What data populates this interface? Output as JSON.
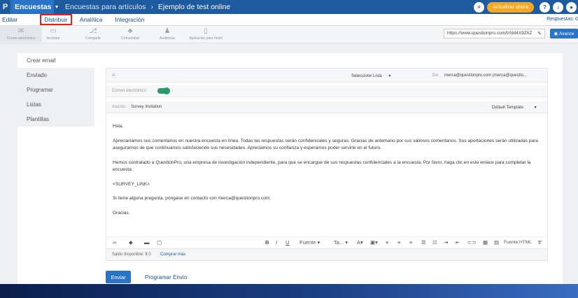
{
  "topbar": {
    "logo": "P",
    "app_menu": "Encuestas",
    "breadcrumb": "Encuestas para artículos",
    "breadcrumb_sep": "›",
    "survey_title": "Ejemplo de test online",
    "upgrade_label": "Actualizar ahora",
    "icons": [
      "search-icon",
      "help-icon",
      "bell-icon",
      "user-icon"
    ]
  },
  "nav": {
    "tabs": [
      "Editar",
      "Distribuir",
      "Analítica",
      "Integración"
    ],
    "active_tab": "Distribuir",
    "responses_label": "Respuestas: 0"
  },
  "tools": [
    {
      "label": "Correo electrónico",
      "icon": "mail-icon"
    },
    {
      "label": "Incrustar",
      "icon": "embed-icon"
    },
    {
      "label": "Compartir",
      "icon": "share-icon"
    },
    {
      "label": "Comunidad",
      "icon": "community-icon"
    },
    {
      "label": "Audiencia",
      "icon": "audience-icon"
    },
    {
      "label": "Aplicación para móvil",
      "icon": "mobile-icon"
    }
  ],
  "url_box": "https://www.questionpro.com/t/AM4X9ZhZ",
  "advance_label": "Avance",
  "side_menu": [
    "Crear email",
    "Enviado",
    "Programar",
    "Listas",
    "Plantillas"
  ],
  "form": {
    "to_label": "A:",
    "select_list": "Seleccione Lista",
    "from_label": "De:",
    "from_value": "merca@questionpro.com (merca@questio...",
    "email_toggle_label": "Correo electrónico:",
    "subject_label": "Asunto:",
    "subject_value": "Survey Invitation",
    "template_value": "Default Template",
    "body": [
      "Hola,",
      "Apreciaríamos sus comentarios en nuestra encuesta en línea. Todas las respuestas serán confidenciales y seguras. Gracias de antemano por sus valiosos comentarios. Sus aportaciones serán utilizadas para asegurarnos de que continuamos satisfaciendo sus necesidades. Apreciamos su confianza y esperamos poder servirle en el futuro.",
      "Hemos contratado a QuestionPro, una empresa de investigación independiente, para que se encargue de sus respuestas confidenciales a la encuesta. Por favor, haga clic en este enlace para completar la encuesta:",
      "<SURVEY_LINK>",
      "Si tiene alguna pregunta, póngase en contacto con merca@questionpro.com.",
      "Gracias."
    ],
    "editor": {
      "bold": "B",
      "italic": "I",
      "underline": "U",
      "font": "Fuente",
      "size": "Ta...",
      "html_label": "Fuente HTML"
    },
    "balance": "Saldo disponible: $ 0",
    "buy_more": "Comprar más"
  },
  "actions": {
    "send": "Enviar",
    "schedule": "Programar Envío"
  }
}
